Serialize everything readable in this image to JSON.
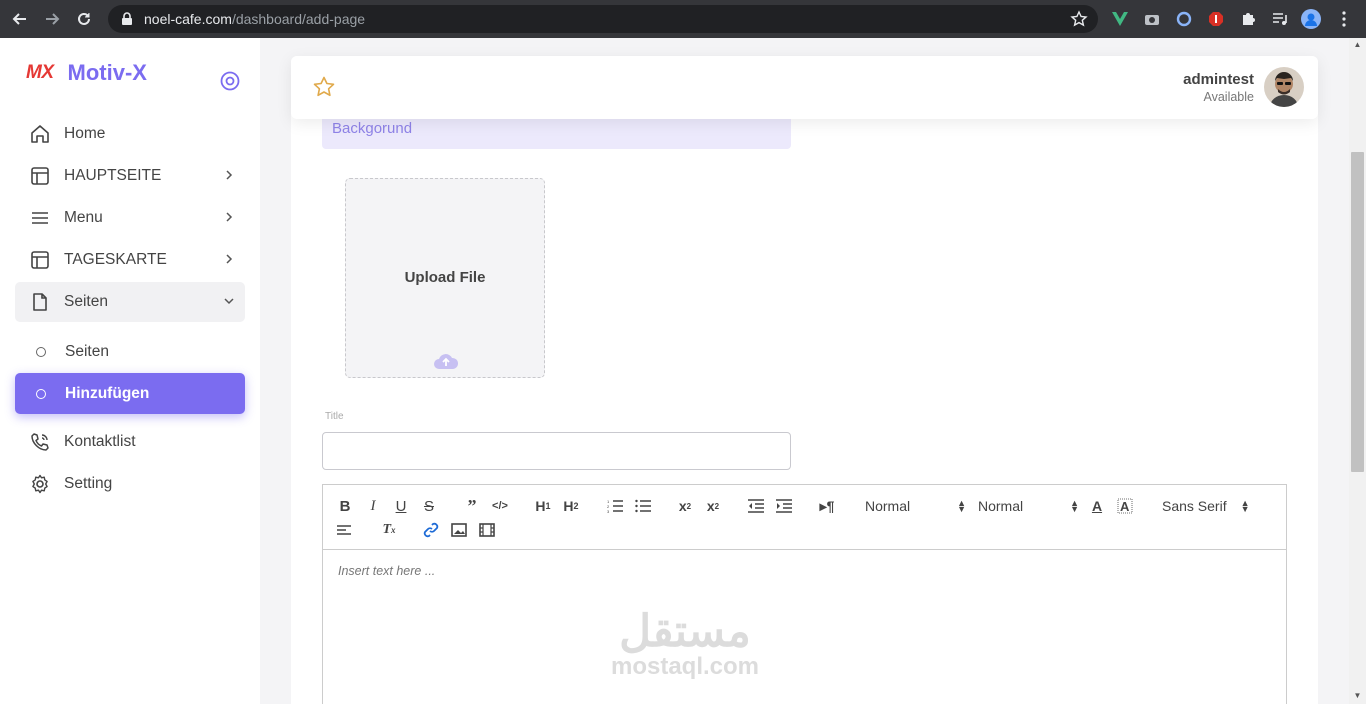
{
  "browser": {
    "url_host": "noel-cafe.com",
    "url_path": "/dashboard/add-page"
  },
  "brand": {
    "logo": "MX",
    "name": "Motiv-X"
  },
  "sidebar": {
    "items": [
      {
        "label": "Home",
        "icon": "home-icon"
      },
      {
        "label": "HAUPTSEITE",
        "icon": "layout-icon"
      },
      {
        "label": "Menu",
        "icon": "menu-lines-icon"
      },
      {
        "label": "TAGESKARTE",
        "icon": "layout-icon"
      },
      {
        "label": "Seiten",
        "icon": "file-icon"
      },
      {
        "label": "Kontaktlist",
        "icon": "phone-icon"
      },
      {
        "label": "Setting",
        "icon": "gear-icon"
      }
    ],
    "subitems": [
      {
        "label": "Seiten"
      },
      {
        "label": "Hinzufügen"
      }
    ]
  },
  "header": {
    "username": "admintest",
    "status": "Available"
  },
  "form": {
    "background_label": "Backgorund",
    "upload_label": "Upload File",
    "title_label": "Title",
    "title_value": ""
  },
  "editor": {
    "header_select": "Normal",
    "size_select": "Normal",
    "font_select": "Sans Serif",
    "placeholder": "Insert text here ..."
  },
  "watermark": {
    "arabic": "مستقل",
    "latin": "mostaql.com"
  },
  "colors": {
    "accent": "#7b6cf0",
    "accent_light": "#ece9fc",
    "logo_red": "#e53935"
  }
}
